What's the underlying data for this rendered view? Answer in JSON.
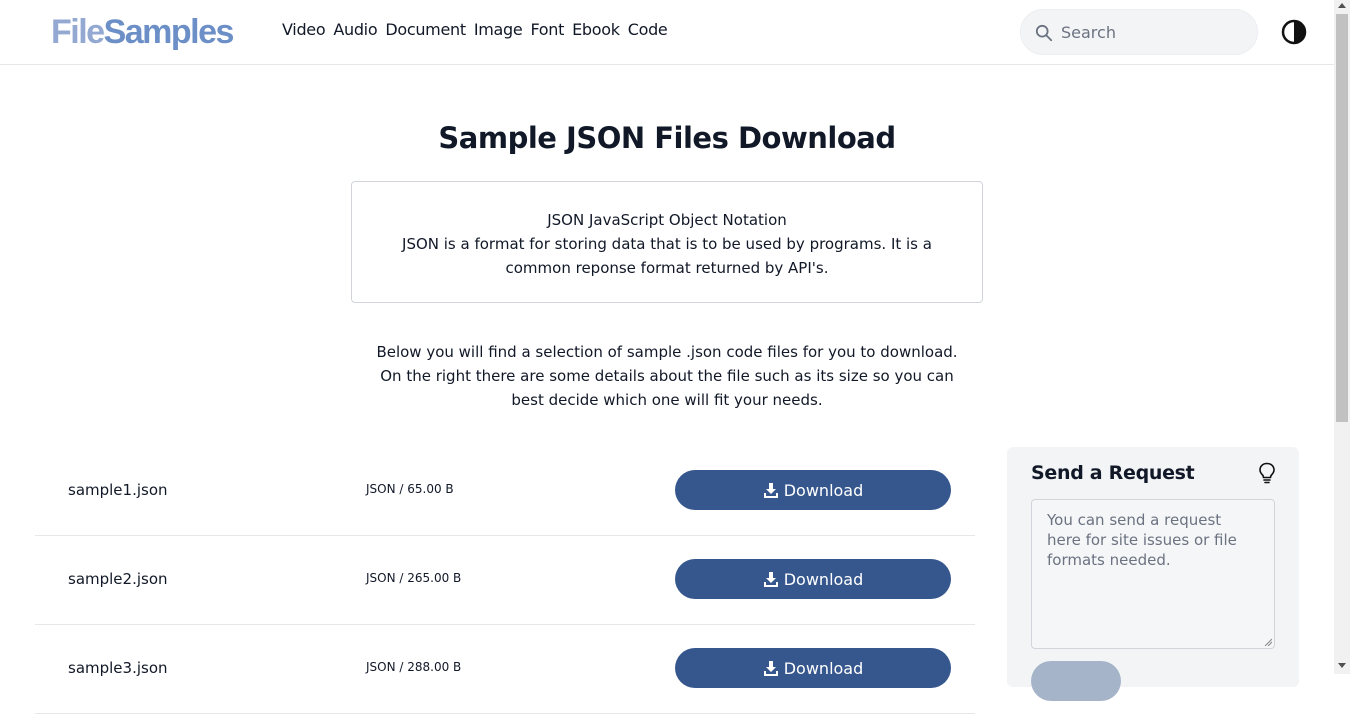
{
  "header": {
    "logo": {
      "part1": "File",
      "part2": "Samples"
    },
    "nav": [
      "Video",
      "Audio",
      "Document",
      "Image",
      "Font",
      "Ebook",
      "Code"
    ],
    "search": {
      "placeholder": "Search",
      "icon": "search-icon"
    },
    "theme_toggle_icon": "contrast-icon"
  },
  "main": {
    "title": "Sample JSON Files Download",
    "info_box": {
      "heading": "JSON JavaScript Object Notation",
      "description": "JSON is a format for storing data that is to be used by programs. It is a common reponse format returned by API's."
    },
    "intro": "Below you will find a selection of sample .json code files for you to download. On the right there are some details about the file such as its size so you can best decide which one will fit your needs.",
    "files": [
      {
        "name": "sample1.json",
        "meta": "JSON / 65.00 B",
        "button": "Download"
      },
      {
        "name": "sample2.json",
        "meta": "JSON / 265.00 B",
        "button": "Download"
      },
      {
        "name": "sample3.json",
        "meta": "JSON / 288.00 B",
        "button": "Download"
      }
    ]
  },
  "request_panel": {
    "title": "Send a Request",
    "icon": "lightbulb-icon",
    "placeholder": "You can send a request here for site issues or file formats needed."
  },
  "colors": {
    "brand_light": "#93a9d2",
    "brand": "#6b8fc6",
    "button": "#36578d",
    "panel_bg": "#f3f4f6"
  }
}
